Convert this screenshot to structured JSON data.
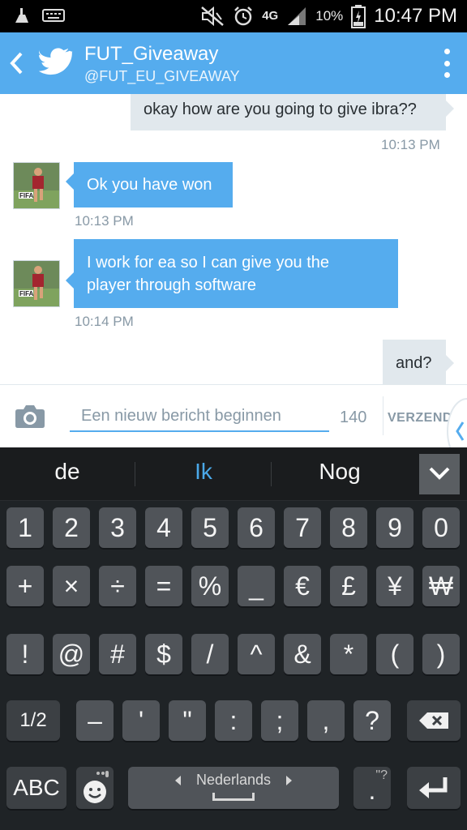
{
  "status_bar": {
    "battery": "10%",
    "network": "4G",
    "time": "10:47 PM"
  },
  "header": {
    "title": "FUT_Giveaway",
    "handle": "@FUT_EU_GIVEAWAY"
  },
  "messages": [
    {
      "sender": "me",
      "text": "okay how are you going to give ibra??",
      "time": "10:13 PM"
    },
    {
      "sender": "them",
      "text": "Ok you have won",
      "time": "10:13 PM"
    },
    {
      "sender": "them",
      "text_line1": "I work for ea so I can give you the",
      "text_line2": "player through software",
      "time": "10:14 PM"
    },
    {
      "sender": "me",
      "text": "and?"
    }
  ],
  "avatar_label": "FIFA",
  "composer": {
    "placeholder": "Een nieuw bericht beginnen",
    "char_count": "140",
    "send_label": "VERZENDEN"
  },
  "keyboard": {
    "suggestions": [
      "de",
      "Ik",
      "Nog"
    ],
    "row1": [
      "1",
      "2",
      "3",
      "4",
      "5",
      "6",
      "7",
      "8",
      "9",
      "0"
    ],
    "row2": [
      "+",
      "×",
      "÷",
      "=",
      "%",
      "_",
      "€",
      "£",
      "¥",
      "₩"
    ],
    "row3": [
      "!",
      "@",
      "#",
      "$",
      "/",
      "^",
      "&",
      "*",
      "(",
      ")"
    ],
    "row4": [
      "1/2",
      "–",
      "'",
      "\"",
      ":",
      ";",
      ",",
      "?"
    ],
    "abc_label": "ABC",
    "language": "Nederlands",
    "emoji_hint": "❞",
    "period_hint": "\"?",
    "period": "."
  },
  "colors": {
    "twitter_blue": "#55acee",
    "my_bubble": "#e1e8ed",
    "keyboard_bg": "#1f2326",
    "suggestion_highlight": "#4aa8e8"
  }
}
